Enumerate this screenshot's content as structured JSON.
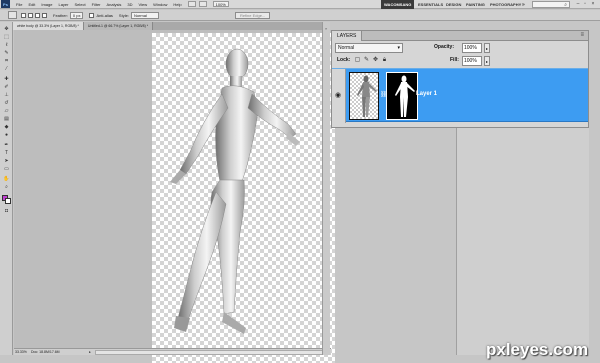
{
  "menubar": {
    "logo": "Ps",
    "items": [
      "File",
      "Edit",
      "Image",
      "Layer",
      "Select",
      "Filter",
      "Analysis",
      "3D",
      "View",
      "Window",
      "Help"
    ],
    "zoom": "100%",
    "workspaces": [
      "WACOMSANG",
      "ESSENTIALS",
      "DESIGN",
      "PAINTING",
      "PHOTOGRAPHY"
    ],
    "active_workspace": "WACOMSANG"
  },
  "optbar": {
    "feather_label": "Feather:",
    "feather_value": "0 px",
    "antialias_label": "Anti-alias",
    "style_label": "Style:",
    "style_value": "Normal",
    "refine_edge_label": "Refine Edge..."
  },
  "tabs": [
    {
      "label": "white body @ 33.3% (Layer 1, RGB/8) *",
      "active": true
    },
    {
      "label": "Untitled-1 @ 66.7% (Layer 1, RGB/8) *",
      "active": false
    }
  ],
  "status": {
    "zoom": "33.33%",
    "doc": "Doc: 18.8M/17.6M"
  },
  "layers_panel": {
    "tab_label": "LAYERS",
    "blend_mode": "Normal",
    "opacity_label": "Opacity:",
    "opacity_value": "100%",
    "lock_label": "Lock:",
    "fill_label": "Fill:",
    "fill_value": "100%",
    "layers": [
      {
        "name": "Layer 1",
        "visible": true,
        "selected": true,
        "has_mask": true
      }
    ]
  },
  "watermark": "pxleyes.com",
  "colors": {
    "foreground": "#c040d0",
    "background": "#ffffff",
    "selection": "#3d9cf2"
  }
}
